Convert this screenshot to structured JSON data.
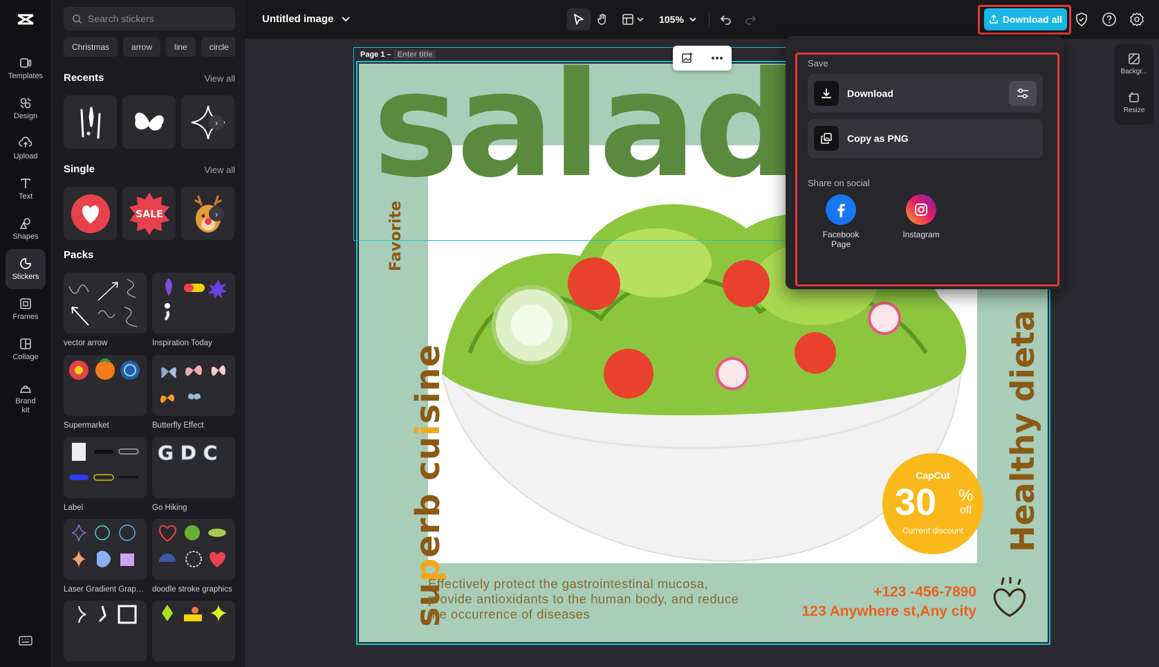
{
  "nav": {
    "items": [
      {
        "label": "Templates",
        "icon": "templates-icon"
      },
      {
        "label": "Design",
        "icon": "design-icon"
      },
      {
        "label": "Upload",
        "icon": "upload-icon"
      },
      {
        "label": "Text",
        "icon": "text-icon"
      },
      {
        "label": "Shapes",
        "icon": "shapes-icon"
      },
      {
        "label": "Stickers",
        "icon": "stickers-icon",
        "active": true
      },
      {
        "label": "Frames",
        "icon": "frames-icon"
      },
      {
        "label": "Collage",
        "icon": "collage-icon"
      },
      {
        "label": "Brand kit",
        "icon": "brand-kit-icon"
      }
    ]
  },
  "stickers": {
    "search_placeholder": "Search stickers",
    "chips": [
      "Christmas",
      "arrow",
      "line",
      "circle"
    ],
    "recents_title": "Recents",
    "single_title": "Single",
    "packs_title": "Packs",
    "view_all": "View all",
    "single_sale_text": "SALE",
    "packs": [
      "vector arrow",
      "Inspiration Today",
      "Supermarket",
      "Butterfly Effect",
      "Label",
      "Go Hiking",
      "Laser Gradient Graph...",
      "doodle stroke graphics"
    ]
  },
  "topbar": {
    "doc_title": "Untitled image",
    "zoom": "105%",
    "download_all": "Download all"
  },
  "page": {
    "label": "Page 1 –",
    "title_placeholder": "Enter title"
  },
  "poster": {
    "title": "salad",
    "favorite": "Favorite",
    "left_text_a": "su",
    "left_text_hl": "p",
    "left_text_b": "erb cu",
    "left_text_hl2": "i",
    "left_text_c": "sine",
    "right_text": "Healthy dieta",
    "description": "Effectively protect the gastrointestinal mucosa, provide antioxidants to the human body, and reduce the occurrence of diseases",
    "phone": "+123 -456-7890",
    "address": "123 Anywhere st,Any city",
    "badge": {
      "brand": "CapCut",
      "number": "30",
      "percent": "%",
      "off": "off",
      "caption": "Current discount"
    }
  },
  "save_menu": {
    "save_label": "Save",
    "download": "Download",
    "copy_png": "Copy as PNG",
    "share_label": "Share on social",
    "facebook": "Facebook Page",
    "instagram": "Instagram"
  },
  "right_panel": {
    "background": "Backgr...",
    "resize": "Resize"
  },
  "colors": {
    "accent": "#19b6e6",
    "highlight": "#e53935",
    "poster_bg": "#a8cdb9",
    "title_green": "#5a8a3e",
    "brown": "#8b5a16",
    "orange": "#e8611f",
    "badge_yellow": "#f9b91a"
  }
}
